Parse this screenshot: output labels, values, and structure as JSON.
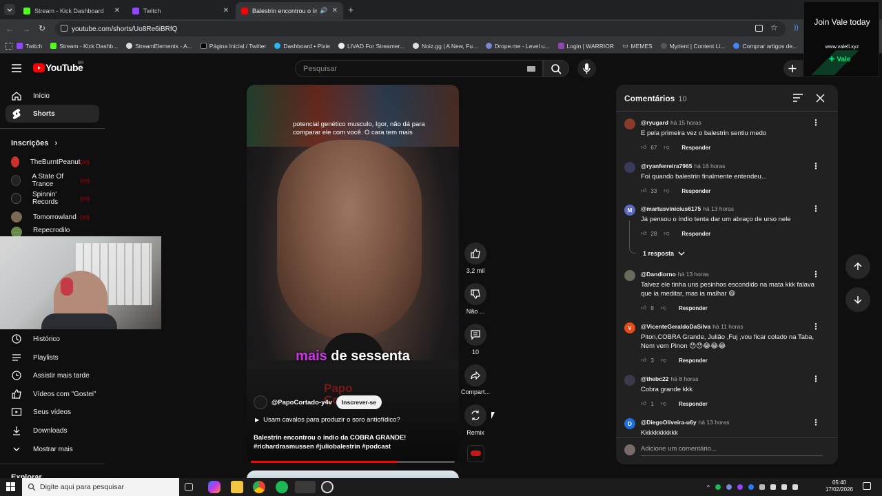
{
  "browser": {
    "tabs": [
      {
        "title": "Stream - Kick Dashboard",
        "color": "#53fc18"
      },
      {
        "title": "Twitch",
        "color": "#9146ff"
      },
      {
        "title": "Balestrin encontrou o índio",
        "color": "#ff0000"
      }
    ],
    "url": "youtube.com/shorts/Uo8Re6iBRfQ",
    "bookmarks": [
      "Twitch",
      "Stream - Kick Dashb...",
      "StreamElements - A...",
      "Página Inicial / Twitter",
      "Dashboard • Pixie",
      "LIVAD For Streamer...",
      "Noiz.gg | A New, Fu...",
      "Drope.me - Level u...",
      "Login | WARRIOR",
      "MEMES",
      "Myrient | Content Li...",
      "Comprar artigos de..."
    ]
  },
  "youtube": {
    "logo": "YouTube",
    "region": "BR",
    "search_placeholder": "Pesquisar"
  },
  "sidebar": {
    "main": [
      {
        "label": "Início",
        "icon": "home-icon"
      },
      {
        "label": "Shorts",
        "icon": "shorts-icon"
      }
    ],
    "subscriptions_title": "Inscrições",
    "subscriptions": [
      {
        "label": "TheBurntPeanut",
        "color": "#c8322a"
      },
      {
        "label": "A State Of Trance",
        "color": "#222222"
      },
      {
        "label": "Spinnin' Records",
        "color": "#1b1b1b"
      },
      {
        "label": "Tomorrowland",
        "color": "#7a6a55"
      },
      {
        "label": "Repecrodilo",
        "color": "#6a8a4a"
      }
    ],
    "you": [
      {
        "label": "Histórico",
        "icon": "history-icon"
      },
      {
        "label": "Playlists",
        "icon": "playlists-icon"
      },
      {
        "label": "Assistir mais tarde",
        "icon": "watch-later-icon"
      },
      {
        "label": "Vídeos com \"Gostei\"",
        "icon": "like-icon"
      },
      {
        "label": "Seus vídeos",
        "icon": "your-videos-icon"
      },
      {
        "label": "Downloads",
        "icon": "download-icon"
      },
      {
        "label": "Mostrar mais",
        "icon": "chevron-down-icon"
      }
    ],
    "explore_title": "Explorar"
  },
  "video": {
    "caption_top": "potencial genético musculo, Igor, não dá para comparar ele com você. O cara tem mais",
    "subtitle_highlight": "mais",
    "subtitle_rest": " de sessenta",
    "watermark": "Papo Cortado",
    "channel": "@PapoCortado-y4v",
    "subscribe_label": "Inscrever-se",
    "music": "Usam cavalos para produzir o soro antiofídico?",
    "description": "Balestrin encontrou o índio da COBRA GRANDE! #richardrasmussen #juliobalestrin #podcast",
    "progress": 0.72
  },
  "actions": {
    "likes": "3,2 mil",
    "dislike": "Não ...",
    "comments": "10",
    "share": "Compart...",
    "remix": "Remix"
  },
  "comments_panel": {
    "title": "Comentários",
    "count": "10",
    "items": [
      {
        "author": "@ryugard",
        "when": "há 15 horas",
        "text": "E pela primeira vez o balestrin sentiu medo",
        "likes": "67",
        "avatar_letter": "",
        "avatar_color": "#8a3a2a"
      },
      {
        "author": "@ryanferreira7965",
        "when": "há 16 horas",
        "text": "Foi quando balestrin finalmente entendeu...",
        "likes": "33",
        "avatar_letter": "",
        "avatar_color": "#3a3a5a"
      },
      {
        "author": "@martusvinicius6175",
        "when": "há 13 horas",
        "text": "Já pensou o índio tenta dar um abraço de urso nele",
        "likes": "28",
        "avatar_letter": "M",
        "avatar_color": "#5c6bc0"
      },
      {
        "author": "@Dandiorno",
        "when": "há 13 horas",
        "text": "Talvez ele tinha uns pesinhos escondido na mata kkk falava que ia meditar, mas ia malhar 😄",
        "likes": "8",
        "avatar_letter": "",
        "avatar_color": "#6a6a5a"
      },
      {
        "author": "@VicenteGeraldoDaSilva",
        "when": "há 11 horas",
        "text": "Piton,COBRA Grande, Julião ,Fuj ,vou ficar colado na Taba, Nem vem Pinon 😯😯😂😂😂",
        "likes": "3",
        "avatar_letter": "V",
        "avatar_color": "#e64a19"
      },
      {
        "author": "@thebc22",
        "when": "há 8 horas",
        "text": "Cobra grande kkk",
        "likes": "1",
        "avatar_letter": "",
        "avatar_color": "#3a3a4a"
      },
      {
        "author": "@DiegoOliveira-u6y",
        "when": "há 13 horas",
        "text": "Kkkkkkkkkkk",
        "likes": "",
        "avatar_letter": "D",
        "avatar_color": "#1e6fd9"
      }
    ],
    "reply_label": "Responder",
    "replies_toggle": "1 resposta",
    "add_comment_placeholder": "Adicione um comentário..."
  },
  "ad": {
    "headline": "Join Vale today",
    "url": "www.valefi.xyz",
    "brand": "Vale",
    "accent": "#00e676"
  },
  "taskbar": {
    "search_placeholder": "Digite aqui para pesquisar",
    "time": "05:40",
    "date": "17/02/2026"
  }
}
